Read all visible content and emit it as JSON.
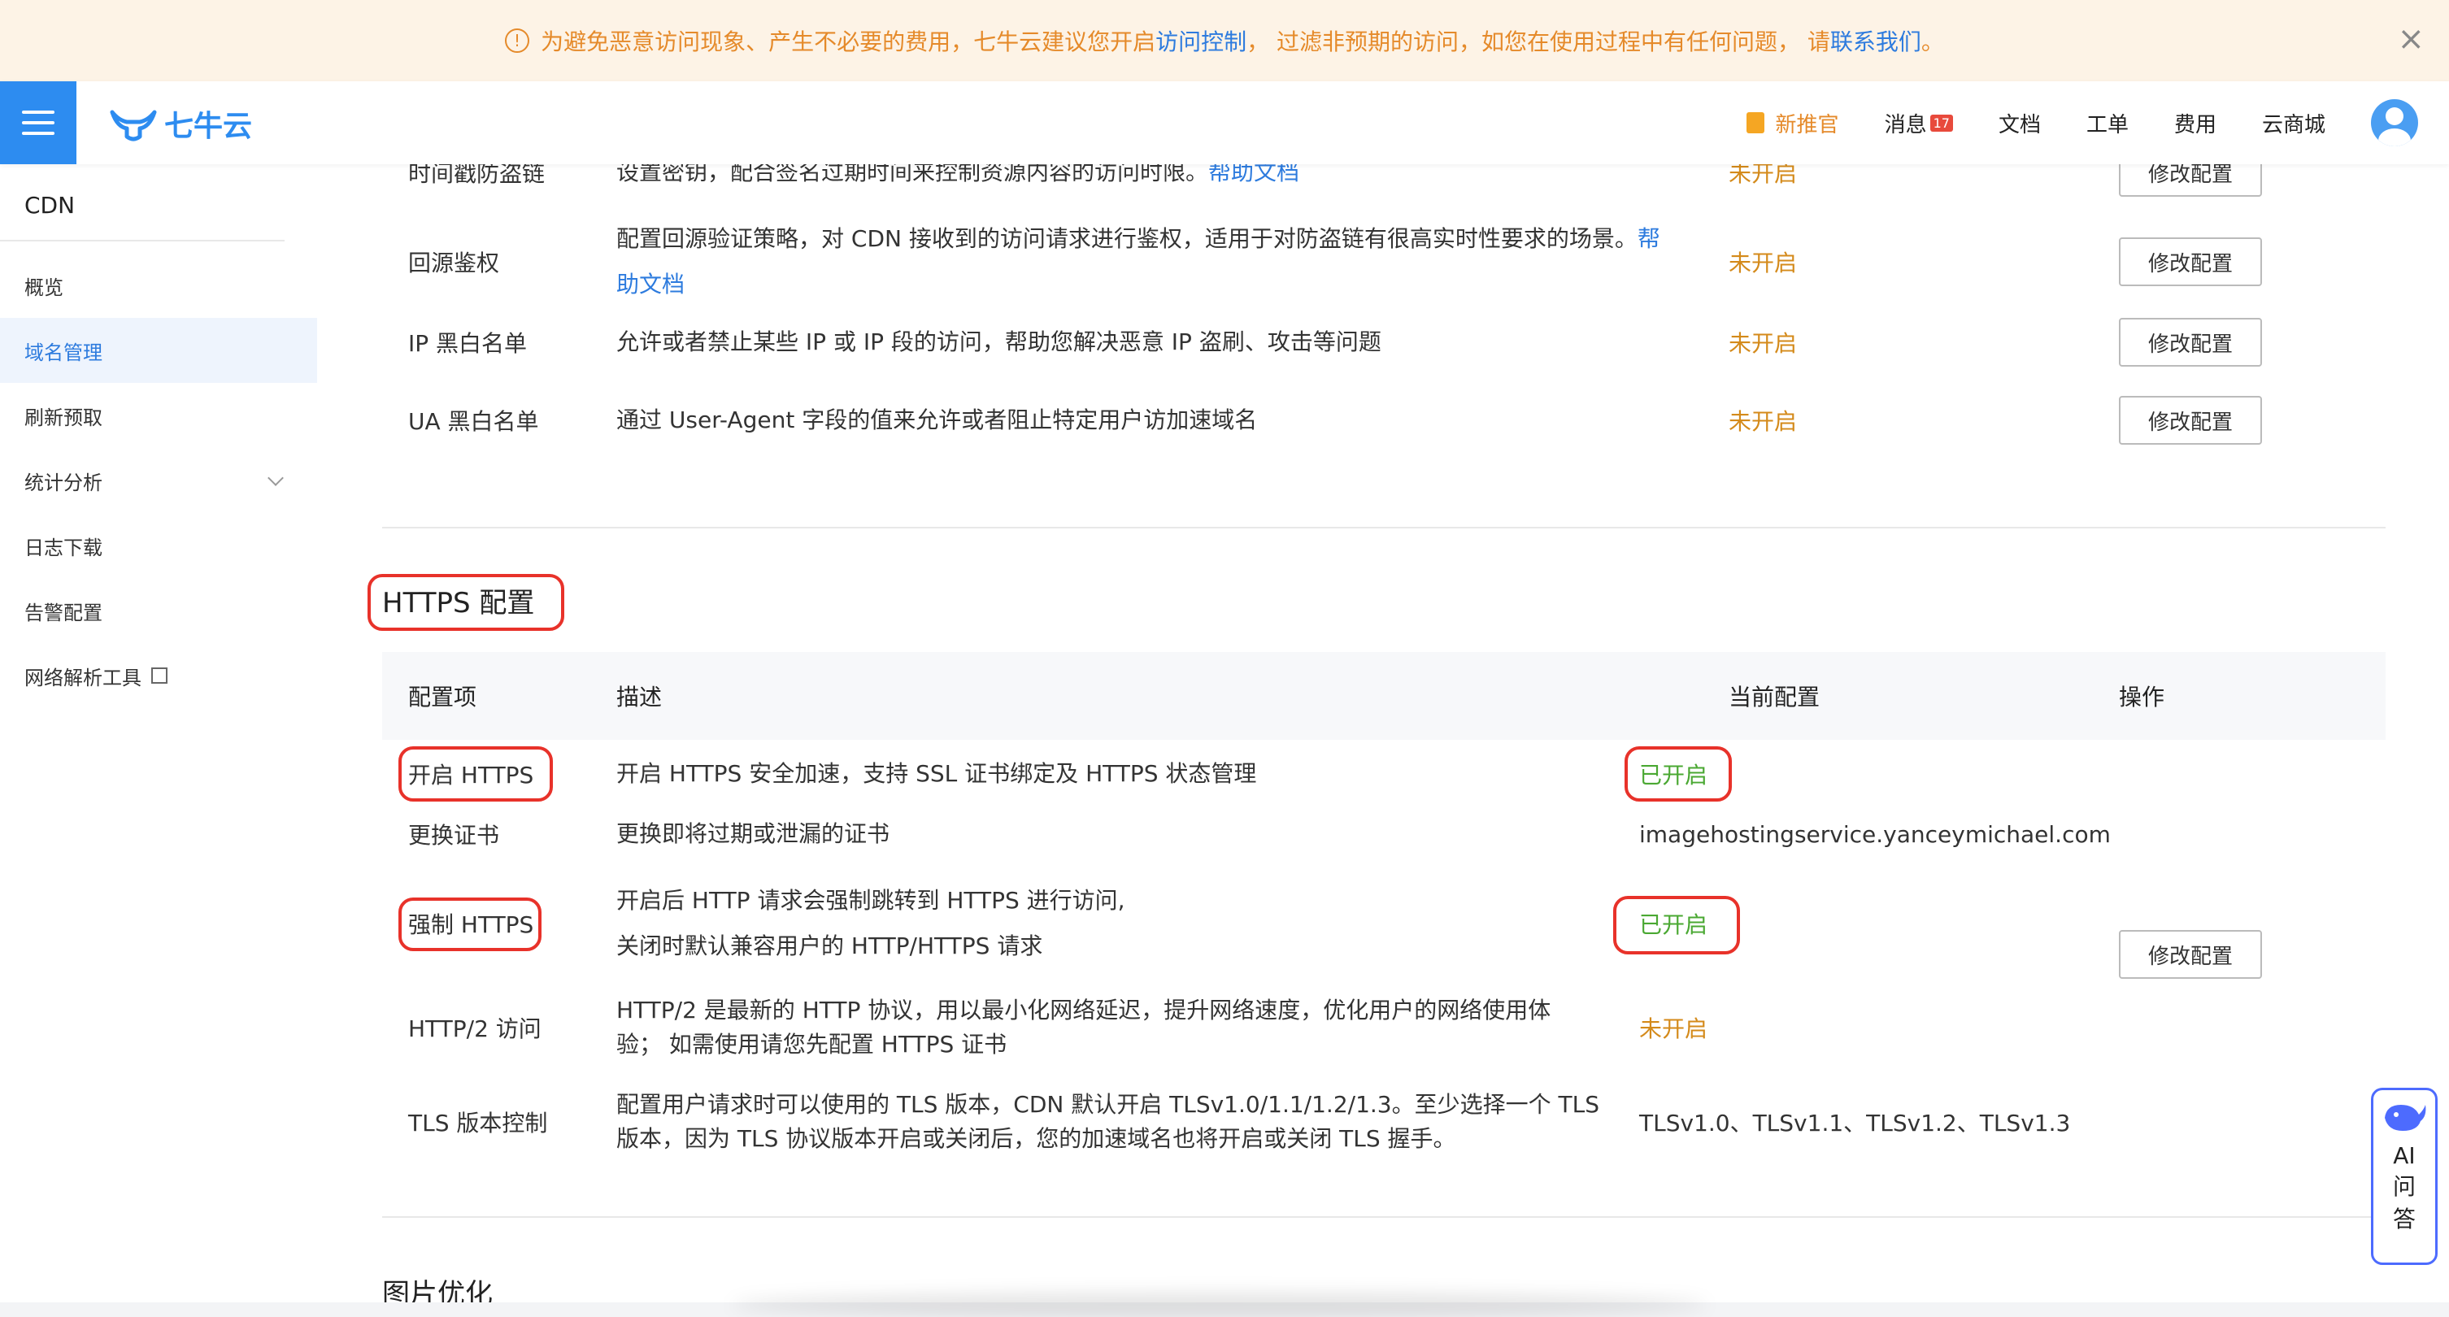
{
  "banner": {
    "text_before": "为避免恶意访问现象、产生不必要的费用，七牛云建议您开启",
    "link_access_control": "访问控制",
    "text_middle": "， 过滤非预期的访问，如您在使用过程中有任何问题， 请",
    "link_contact": "联系我们",
    "text_end": "。",
    "close_glyph": "×"
  },
  "header": {
    "logo_text": "七牛云",
    "nav": {
      "recommend": "新推官",
      "messages": "消息",
      "messages_count": "17",
      "docs": "文档",
      "tickets": "工单",
      "billing": "费用",
      "mall": "云商城"
    }
  },
  "sidebar": {
    "title": "CDN",
    "items": [
      {
        "label": "概览"
      },
      {
        "label": "域名管理"
      },
      {
        "label": "刷新预取"
      },
      {
        "label": "统计分析"
      },
      {
        "label": "日志下载"
      },
      {
        "label": "告警配置"
      },
      {
        "label": "网络解析工具"
      }
    ]
  },
  "access_rows": [
    {
      "name": "时间戳防盗链",
      "desc": "设置密钥，配合签名过期时间来控制资源内容的访问时限。",
      "desc_link": "帮助文档",
      "status": "未开启",
      "action": "修改配置"
    },
    {
      "name": "回源鉴权",
      "desc": "配置回源验证策略，对 CDN 接收到的访问请求进行鉴权，适用于对防盗链有很高实时性要求的场景。",
      "desc_link_a": "帮",
      "desc_link_b": "助文档",
      "status": "未开启",
      "action": "修改配置"
    },
    {
      "name": "IP 黑白名单",
      "desc": "允许或者禁止某些 IP 或 IP 段的访问，帮助您解决恶意 IP 盗刷、攻击等问题",
      "status": "未开启",
      "action": "修改配置"
    },
    {
      "name": "UA 黑白名单",
      "desc": "通过 User-Agent 字段的值来允许或者阻止特定用户访加速域名",
      "status": "未开启",
      "action": "修改配置"
    }
  ],
  "https_section": {
    "title": "HTTPS 配置",
    "headers": {
      "item": "配置项",
      "desc": "描述",
      "current": "当前配置",
      "action": "操作"
    },
    "rows": [
      {
        "name": "开启 HTTPS",
        "desc": "开启 HTTPS 安全加速，支持 SSL 证书绑定及 HTTPS 状态管理",
        "status": "已开启"
      },
      {
        "name": "更换证书",
        "desc": "更换即将过期或泄漏的证书",
        "status": "imagehostingservice.yanceymichael.com"
      },
      {
        "name": "强制 HTTPS",
        "desc_line1": "开启后 HTTP 请求会强制跳转到 HTTPS 进行访问,",
        "desc_line2": "关闭时默认兼容用户的 HTTP/HTTPS 请求",
        "status": "已开启"
      },
      {
        "name": "HTTP/2 访问",
        "desc_line1": "HTTP/2 是最新的 HTTP 协议，用以最小化网络延迟，提升网络速度，优化用户的网络使用体",
        "desc_line2": "验； 如需使用请您先配置 HTTPS 证书",
        "status": "未开启"
      },
      {
        "name": "TLS 版本控制",
        "desc_line1": "配置用户请求时可以使用的 TLS 版本，CDN 默认开启 TLSv1.0/1.1/1.2/1.3。至少选择一个 TLS",
        "desc_line2": "版本，因为 TLS 协议版本开启或关闭后，您的加速域名也将开启或关闭 TLS 握手。",
        "status": "TLSv1.0、TLSv1.1、TLSv1.2、TLSv1.3"
      }
    ],
    "action": "修改配置"
  },
  "image_section": {
    "title": "图片优化"
  },
  "ai_widget": {
    "label_a": "AI",
    "label_b": "问",
    "label_c": "答"
  },
  "colors": {
    "accent": "#2d8cf0",
    "warning": "#d48a1a",
    "success": "#4aa832",
    "highlight": "#e8322a",
    "banner_bg": "#fdf3e6"
  }
}
